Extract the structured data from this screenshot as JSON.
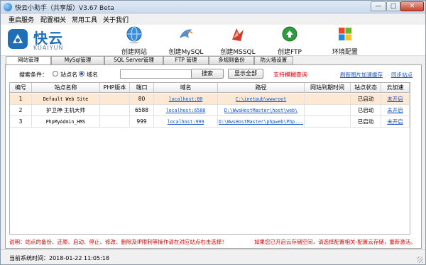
{
  "window": {
    "title": "快云小助手（共享版）V3.67 Beta",
    "min_glyph": "—",
    "max_glyph": "□",
    "close_glyph": "✕"
  },
  "menu": [
    "重启服务",
    "配置相关",
    "常用工具",
    "关于我们"
  ],
  "logo": {
    "cn": "快云",
    "en": "KUAIYUN"
  },
  "toolbar": [
    {
      "label": "创建网站",
      "icon": "globe-icon"
    },
    {
      "label": "创建MySQL",
      "icon": "mysql-icon"
    },
    {
      "label": "创建MSSQL",
      "icon": "mssql-icon"
    },
    {
      "label": "创建FTP",
      "icon": "ftp-icon"
    },
    {
      "label": "环境配置",
      "icon": "windows-icon"
    }
  ],
  "tabs": [
    "网站管理",
    "MySql管理",
    "SQL Server管理",
    "FTP 管理",
    "多规则备份",
    "防火墙设置"
  ],
  "active_tab": 0,
  "search": {
    "label": "搜索条件：",
    "options": [
      "站点名",
      "域名"
    ],
    "selected": 1,
    "value": "",
    "search_button": "搜索",
    "show_all_button": "显示全部",
    "fuzzy_note": "支持模糊查询",
    "refresh_link": "刷新图片加速缓存",
    "sync_link": "同步站点"
  },
  "table": {
    "columns": [
      "编号",
      "站点名称",
      "PHP版本",
      "端口",
      "域名",
      "路径",
      "网站到期时间",
      "站点状态",
      "云加速"
    ],
    "rows": [
      {
        "id": "1",
        "name": "Default Web Site",
        "php": "",
        "port": "80",
        "domain": "localhost:80",
        "path": "C:\\inetpub\\wwwroot",
        "expire": "",
        "status": "已启动",
        "cloud": "未开启",
        "selected": true
      },
      {
        "id": "2",
        "name": "护卫神·主机大师",
        "php": "",
        "port": "6588",
        "domain": "localhost:6588",
        "path": "D:\\WwsHostMaster\\host\\web\\",
        "expire": "",
        "status": "已启动",
        "cloud": "未开启",
        "selected": false
      },
      {
        "id": "3",
        "name": "PhpMyAdmin_HMS",
        "php": "",
        "port": "999",
        "domain": "localhost:999",
        "path": "D:\\WwsHostMaster\\phpweb\\Php...",
        "expire": "",
        "status": "已启动",
        "cloud": "未开启",
        "selected": false
      }
    ]
  },
  "notes": {
    "left": "说明：站点的备份、还原、启动、停止、修改、删除及IP限制等操作请在对应站点右击选择！",
    "right": "如果您已开启云存储空间，请选择配置相关-配置云存储，重新激活。"
  },
  "status": {
    "time": "当前系统时间：2018-01-22 11:05:18"
  },
  "colors": {
    "accent": "#1f6fb8",
    "link": "#1a54c4",
    "warning": "#d40000",
    "selected_row": "#fde9d3"
  }
}
